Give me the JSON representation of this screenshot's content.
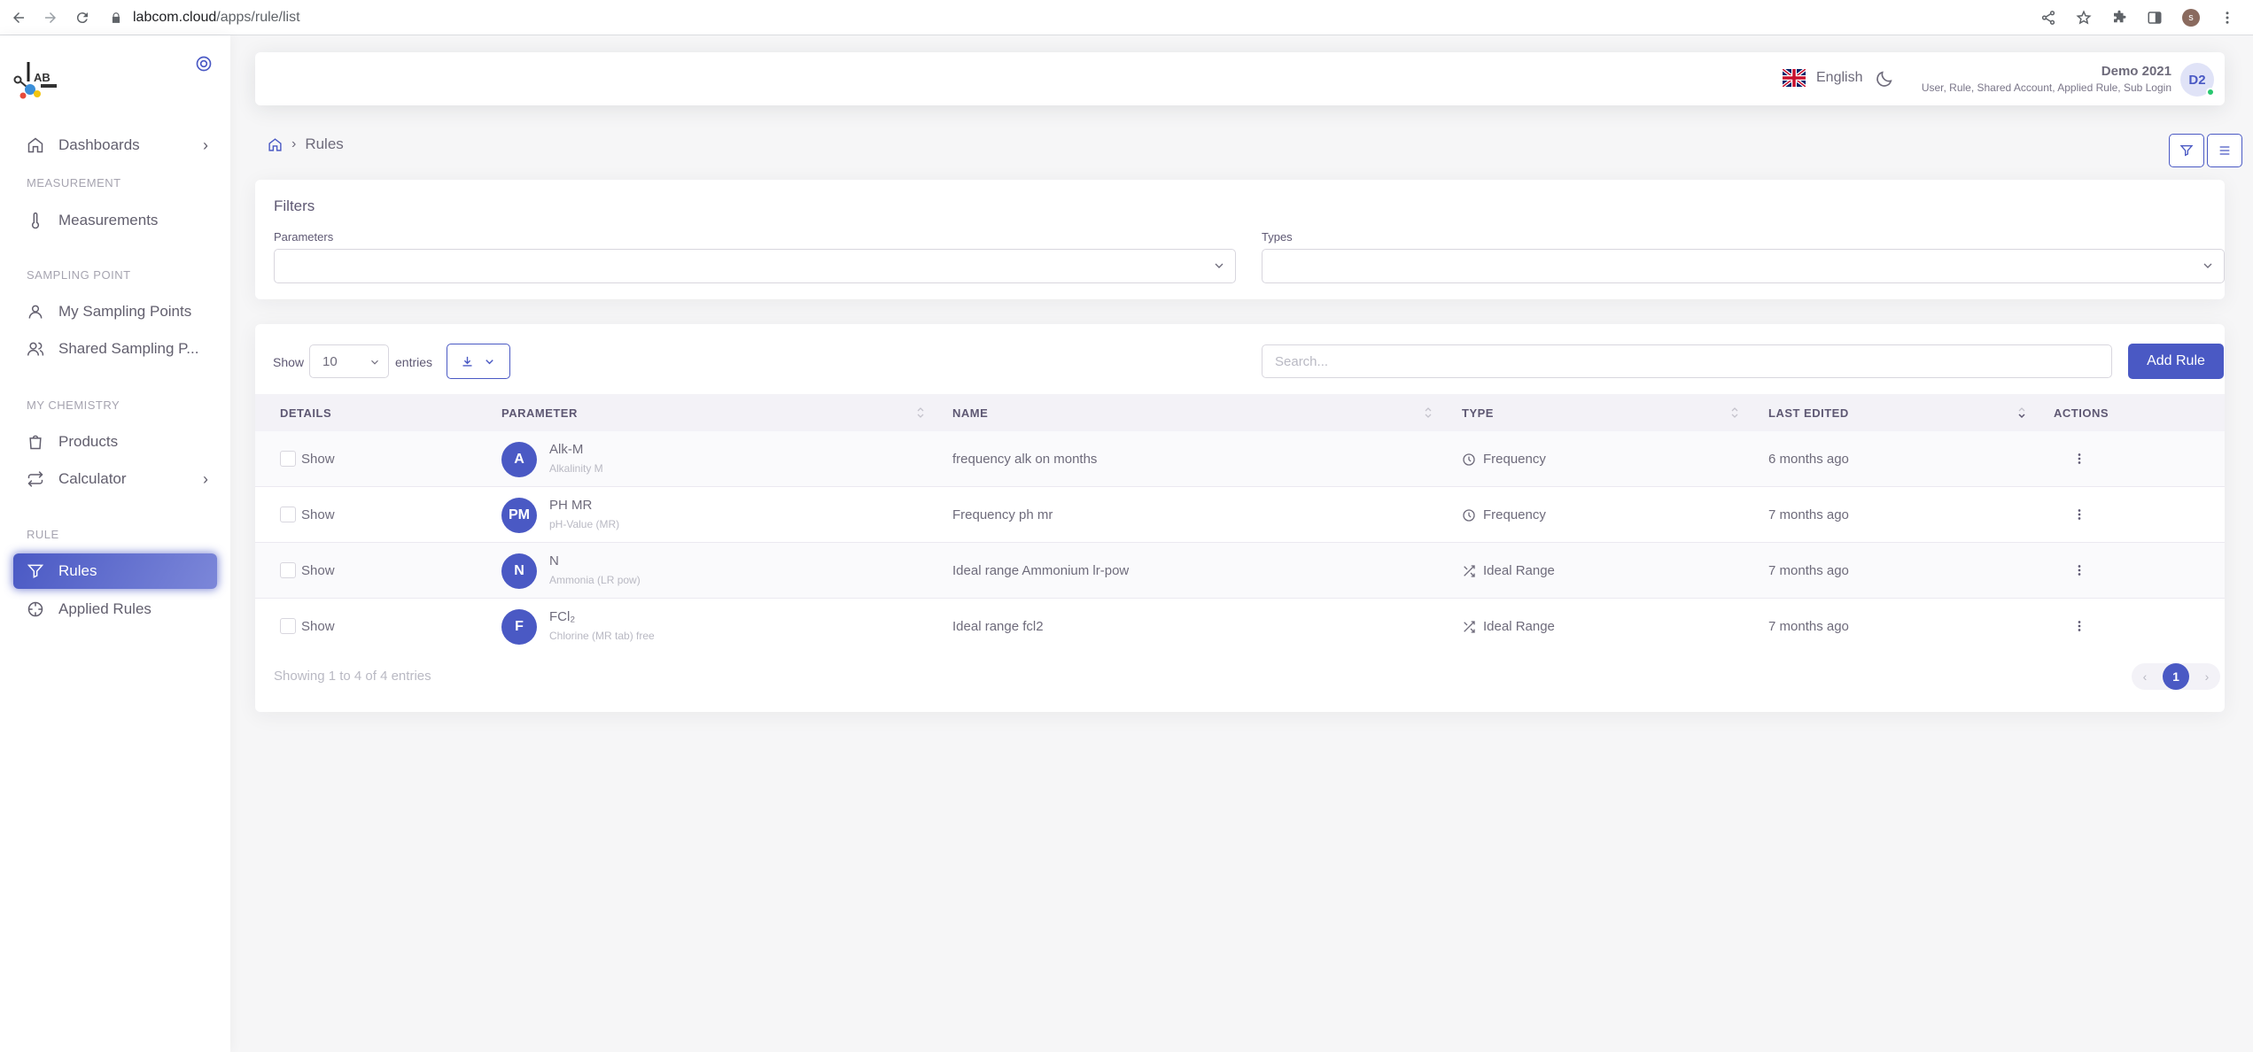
{
  "browser": {
    "url_host": "labcom.cloud",
    "url_path": "/apps/rule/list",
    "profile_initial": "s"
  },
  "sidebar": {
    "logo_text": "AB",
    "dashboards": "Dashboards",
    "section_measurement": "MEASUREMENT",
    "measurements": "Measurements",
    "section_sampling": "SAMPLING POINT",
    "my_sampling_points": "My Sampling Points",
    "shared_sampling_points": "Shared Sampling P...",
    "section_chemistry": "MY CHEMISTRY",
    "products": "Products",
    "calculator": "Calculator",
    "section_rule": "RULE",
    "rules": "Rules",
    "applied_rules": "Applied Rules"
  },
  "topbar": {
    "language": "English",
    "user_name": "Demo 2021",
    "user_roles": "User, Rule, Shared Account, Applied Rule, Sub Login",
    "avatar_initials": "D2"
  },
  "breadcrumb": {
    "current": "Rules"
  },
  "filters": {
    "title": "Filters",
    "parameters_label": "Parameters",
    "types_label": "Types"
  },
  "table_controls": {
    "show_label": "Show",
    "entries_value": "10",
    "entries_label": "entries",
    "search_placeholder": "Search...",
    "add_rule_label": "Add Rule"
  },
  "table": {
    "headers": {
      "details": "DETAILS",
      "parameter": "PARAMETER",
      "name": "NAME",
      "type": "TYPE",
      "last_edited": "LAST EDITED",
      "actions": "ACTIONS"
    },
    "rows": [
      {
        "details": "Show",
        "avatar": "A",
        "param": "Alk-M",
        "param_sub": "Alkalinity M",
        "name": "frequency alk on months",
        "type": "Frequency",
        "type_icon": "clock-icon",
        "edited": "6 months ago"
      },
      {
        "details": "Show",
        "avatar": "PM",
        "param": "PH MR",
        "param_sub": "pH-Value (MR)",
        "name": "Frequency ph mr",
        "type": "Frequency",
        "type_icon": "clock-icon",
        "edited": "7 months ago"
      },
      {
        "details": "Show",
        "avatar": "N",
        "param": "N",
        "param_sub": "Ammonia (LR pow)",
        "name": "Ideal range Ammonium lr-pow",
        "type": "Ideal Range",
        "type_icon": "shuffle-icon",
        "edited": "7 months ago"
      },
      {
        "details": "Show",
        "avatar": "F",
        "param": "FCl₂",
        "param_sub": "Chlorine (MR tab) free",
        "name": "Ideal range fcl2",
        "type": "Ideal Range",
        "type_icon": "shuffle-icon",
        "edited": "7 months ago"
      }
    ],
    "footer": "Showing 1 to 4 of 4 entries",
    "current_page": "1"
  },
  "colors": {
    "primary": "#4a59c4",
    "online": "#28c76f"
  }
}
